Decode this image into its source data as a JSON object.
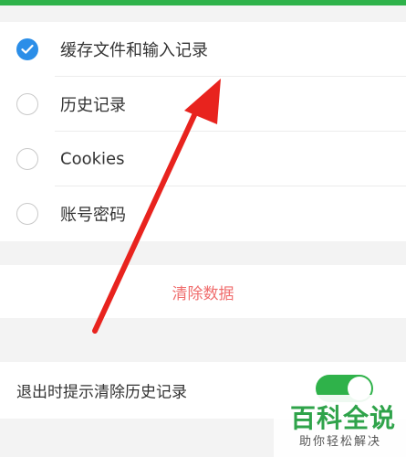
{
  "colors": {
    "accent_green": "#2fb24a",
    "checked_blue": "#2b8ee8",
    "clear_red": "#f06e6e",
    "arrow_red": "#e8231e",
    "watermark_green": "#2fa34a"
  },
  "options": [
    {
      "label": "缓存文件和输入记录",
      "checked": true
    },
    {
      "label": "历史记录",
      "checked": false
    },
    {
      "label": "Cookies",
      "checked": false
    },
    {
      "label": "账号密码",
      "checked": false
    }
  ],
  "clear_button": {
    "label": "清除数据"
  },
  "exit_setting": {
    "label": "退出时提示清除历史记录",
    "toggle_on": true
  },
  "watermark": {
    "title": "百科全说",
    "subtitle": "助你轻松解决"
  }
}
